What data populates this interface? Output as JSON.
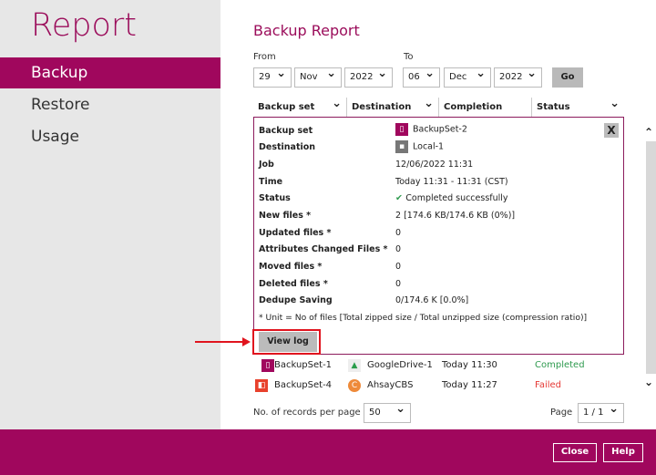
{
  "sidebar": {
    "title": "Report",
    "items": [
      {
        "label": "Backup",
        "selected": true
      },
      {
        "label": "Restore"
      },
      {
        "label": "Usage"
      }
    ]
  },
  "main": {
    "title": "Backup Report",
    "from": {
      "label": "From",
      "day": "29",
      "month": "Nov",
      "year": "2022"
    },
    "to": {
      "label": "To",
      "day": "06",
      "month": "Dec",
      "year": "2022"
    },
    "go_label": "Go",
    "columns": [
      "Backup set",
      "Destination",
      "Completion",
      "Status"
    ],
    "detail": {
      "rows": [
        {
          "label": "Backup set",
          "value": "BackupSet-2"
        },
        {
          "label": "Destination",
          "value": "Local-1"
        },
        {
          "label": "Job",
          "value": "12/06/2022 11:31"
        },
        {
          "label": "Time",
          "value": "Today 11:31 - 11:31 (CST)"
        },
        {
          "label": "Status",
          "value": "Completed successfully"
        },
        {
          "label": "New files *",
          "value": "2 [174.6 KB/174.6 KB (0%)]"
        },
        {
          "label": "Updated files *",
          "value": "0"
        },
        {
          "label": "Attributes Changed Files *",
          "value": "0"
        },
        {
          "label": "Moved files *",
          "value": "0"
        },
        {
          "label": "Deleted files *",
          "value": "0"
        },
        {
          "label": "Dedupe Saving",
          "value": "0/174.6 K [0.0%]"
        }
      ],
      "note": "* Unit = No of files [Total zipped size / Total unzipped size (compression ratio)]",
      "view_log_label": "View log",
      "close_label": "X"
    },
    "rows": [
      {
        "backup_set": "BackupSet-1",
        "destination": "GoogleDrive-1",
        "completion": "Today 11:30",
        "status": "Completed",
        "status_color": "#2e9a4e"
      },
      {
        "backup_set": "BackupSet-4",
        "destination": "AhsayCBS",
        "completion": "Today 11:27",
        "status": "Failed",
        "status_color": "#e53935"
      }
    ],
    "records_label": "No. of records per page",
    "records_value": "50",
    "page_label": "Page",
    "page_value": "1 / 1"
  },
  "footer": {
    "close_label": "Close",
    "help_label": "Help"
  },
  "colors": {
    "brand": "#a0075d",
    "annotation": "#e0141e"
  }
}
